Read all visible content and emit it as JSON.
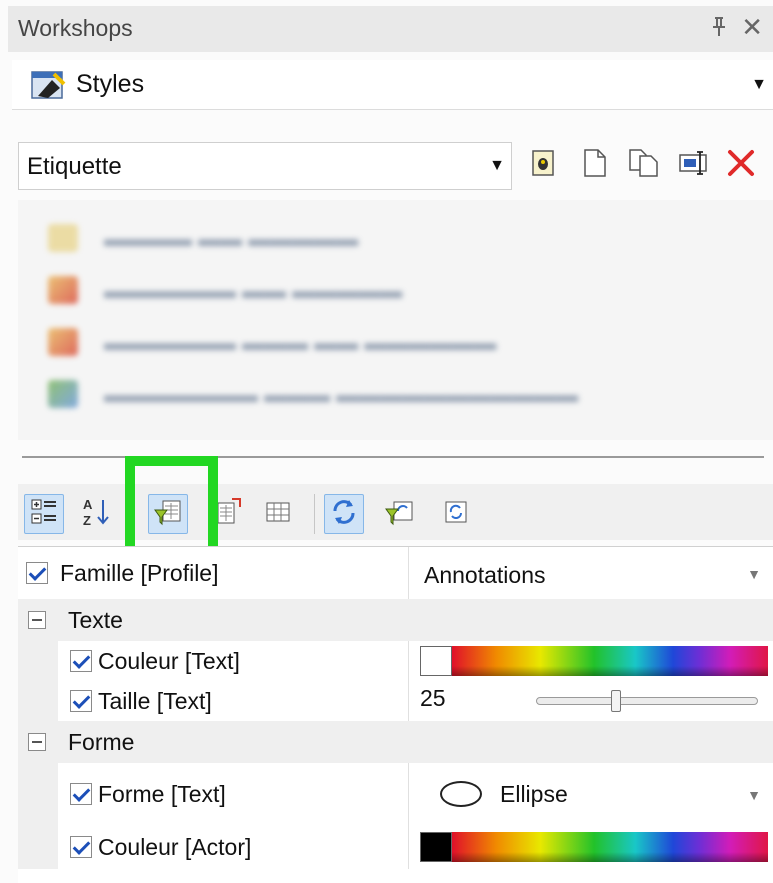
{
  "panel": {
    "title": "Workshops",
    "pin_glyph": "Ѩ",
    "close_glyph": "✕"
  },
  "styles_select": {
    "label": "Styles",
    "icon": "styles-icon"
  },
  "style_combo": {
    "value": "Etiquette"
  },
  "style_tools": [
    {
      "name": "edit-style-icon"
    },
    {
      "name": "new-style-icon"
    },
    {
      "name": "duplicate-style-icon"
    },
    {
      "name": "rename-style-icon"
    },
    {
      "name": "delete-style-icon",
      "color": "#e02a2a"
    }
  ],
  "toolbar": {
    "buttons": [
      {
        "name": "categorized-view-icon",
        "active": true
      },
      {
        "name": "alphabetical-sort-icon",
        "active": false
      },
      {
        "name": "filter-properties-icon",
        "active": true,
        "highlighted": true
      },
      {
        "name": "property-page-icon",
        "active": false
      },
      {
        "name": "grid-view-icon",
        "active": false
      },
      {
        "name": "refresh-icon",
        "active": true
      },
      {
        "name": "filter-refresh-icon",
        "active": false
      },
      {
        "name": "auto-refresh-icon",
        "active": false
      }
    ],
    "highlight_color": "#22d722"
  },
  "properties": {
    "profile": {
      "label": "Famille [Profile]",
      "value": "Annotations",
      "checked": true
    },
    "categories": [
      {
        "label": "Texte",
        "items": [
          {
            "label": "Couleur [Text]",
            "type": "color",
            "swatch": "#ffffff",
            "checked": true
          },
          {
            "label": "Taille [Text]",
            "type": "slider",
            "value": "25",
            "slider_fraction": 0.36,
            "checked": true
          }
        ]
      },
      {
        "label": "Forme",
        "items": [
          {
            "label": "Forme [Text]",
            "type": "shape",
            "value": "Ellipse",
            "checked": true
          },
          {
            "label": "Couleur [Actor]",
            "type": "color",
            "swatch": "#000000",
            "checked": true
          }
        ]
      }
    ]
  },
  "colors": {
    "accent_blue": "#1c4fb8",
    "active_button_bg": "#cfe3f7",
    "delete_red": "#e02a2a"
  }
}
